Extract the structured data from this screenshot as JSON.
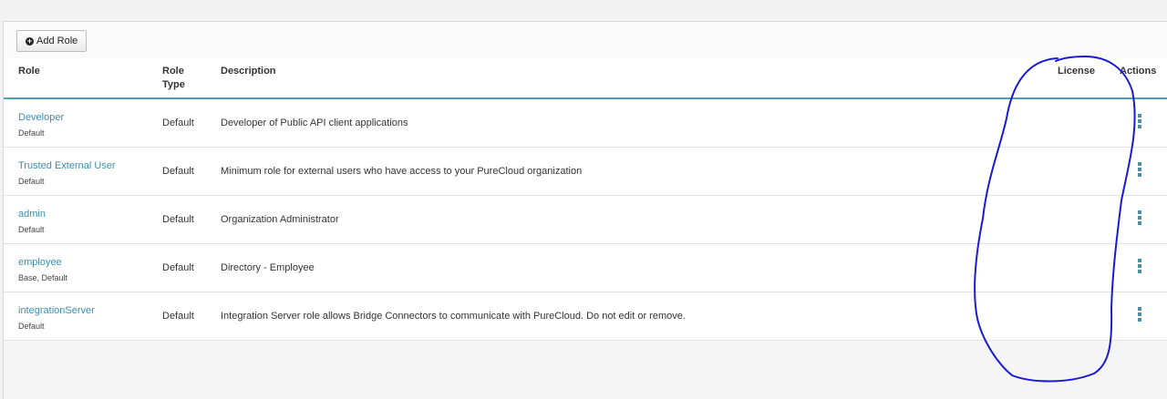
{
  "toolbar": {
    "add_role_label": "Add Role"
  },
  "columns": {
    "role": "Role",
    "role_type_line1": "Role",
    "role_type_line2": "Type",
    "description": "Description",
    "license": "License",
    "actions": "Actions"
  },
  "rows": [
    {
      "name": "Developer",
      "sub": "Default",
      "type": "Default",
      "description": "Developer of Public API client applications"
    },
    {
      "name": "Trusted External User",
      "sub": "Default",
      "type": "Default",
      "description": "Minimum role for external users who have access to your PureCloud organization"
    },
    {
      "name": "admin",
      "sub": "Default",
      "type": "Default",
      "description": "Organization Administrator"
    },
    {
      "name": "employee",
      "sub": "Base, Default",
      "type": "Default",
      "description": "Directory - Employee"
    },
    {
      "name": "integrationServer",
      "sub": "Default",
      "type": "Default",
      "description": "Integration Server role allows Bridge Connectors to communicate with PureCloud. Do not edit or remove."
    }
  ],
  "colors": {
    "link": "#3a8fb0",
    "header_rule": "#4aa0b5",
    "annotation_ink": "#1a1ad6"
  },
  "icons": {
    "add": "plus-circle-icon",
    "row_menu": "kebab-menu-icon"
  }
}
